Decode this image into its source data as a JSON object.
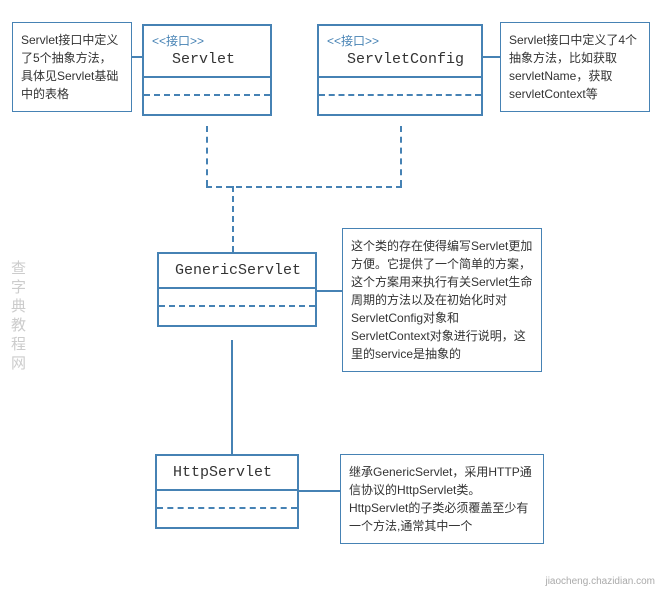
{
  "stereotype_label": "<<接口>>",
  "classes": {
    "servlet": {
      "name": "Servlet"
    },
    "servletConfig": {
      "name": "ServletConfig"
    },
    "genericServlet": {
      "name": "GenericServlet"
    },
    "httpServlet": {
      "name": "HttpServlet"
    }
  },
  "notes": {
    "servlet": "Servlet接口中定义了5个抽象方法，具体见Servlet基础中的表格",
    "servletConfig": "Servlet接口中定义了4个抽象方法，比如获取servletName，获取servletContext等",
    "genericServlet": "这个类的存在使得编写Servlet更加方便。它提供了一个简单的方案，这个方案用来执行有关Servlet生命周期的方法以及在初始化时对ServletConfig对象和ServletContext对象进行说明，这里的service是抽象的",
    "httpServlet": "继承GenericServlet，采用HTTP通信协议的HttpServlet类。HttpServlet的子类必须覆盖至少有一个方法,通常其中一个"
  },
  "watermark": "查字典教程网",
  "credit": "jiaocheng.chazidian.com",
  "chart_data": {
    "type": "uml_class_diagram",
    "nodes": [
      {
        "id": "Servlet",
        "stereotype": "接口",
        "kind": "interface"
      },
      {
        "id": "ServletConfig",
        "stereotype": "接口",
        "kind": "interface"
      },
      {
        "id": "GenericServlet",
        "kind": "class"
      },
      {
        "id": "HttpServlet",
        "kind": "class"
      }
    ],
    "edges": [
      {
        "from": "GenericServlet",
        "to": "Servlet",
        "type": "realization"
      },
      {
        "from": "GenericServlet",
        "to": "ServletConfig",
        "type": "realization"
      },
      {
        "from": "HttpServlet",
        "to": "GenericServlet",
        "type": "generalization"
      }
    ],
    "annotations": [
      {
        "attachedTo": "Servlet",
        "text": "Servlet接口中定义了5个抽象方法，具体见Servlet基础中的表格"
      },
      {
        "attachedTo": "ServletConfig",
        "text": "Servlet接口中定义了4个抽象方法，比如获取servletName，获取servletContext等"
      },
      {
        "attachedTo": "GenericServlet",
        "text": "这个类的存在使得编写Servlet更加方便。它提供了一个简单的方案，这个方案用来执行有关Servlet生命周期的方法以及在初始化时对ServletConfig对象和ServletContext对象进行说明，这里的service是抽象的"
      },
      {
        "attachedTo": "HttpServlet",
        "text": "继承GenericServlet，采用HTTP通信协议的HttpServlet类。HttpServlet的子类必须覆盖至少有一个方法,通常其中一个"
      }
    ]
  }
}
